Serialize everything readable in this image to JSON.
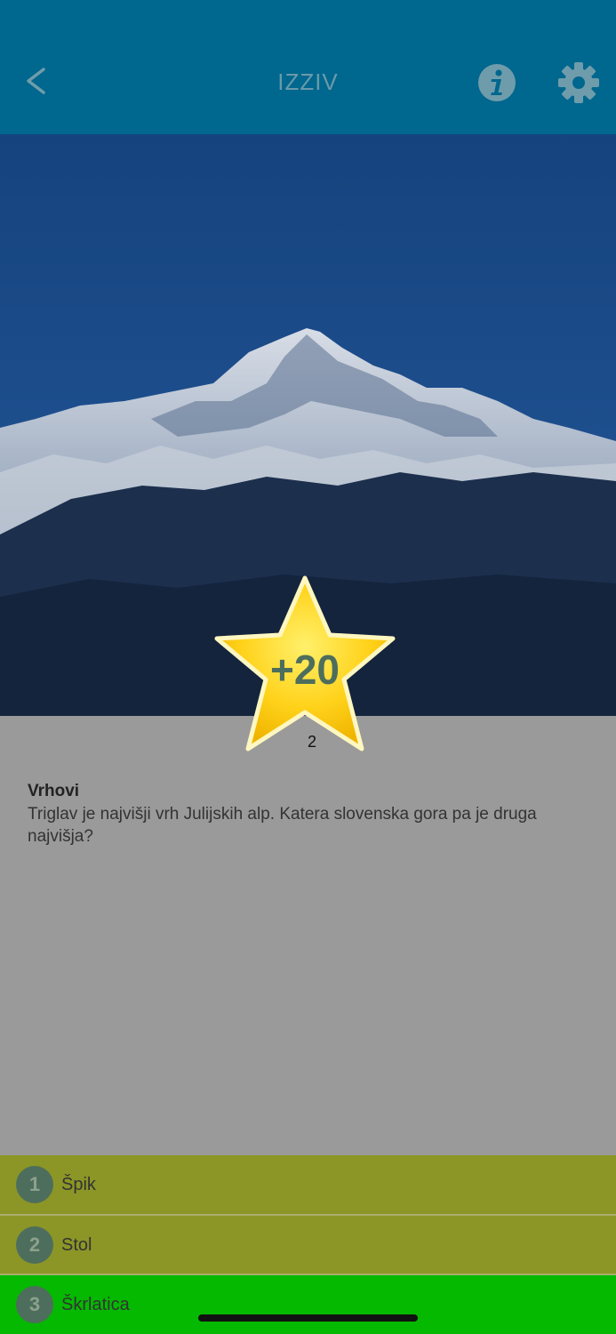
{
  "header": {
    "title": "IZZIV",
    "icons": {
      "back": "chevron-left-icon",
      "info": "info-icon",
      "settings": "gear-icon"
    }
  },
  "reward": {
    "value": "+20",
    "level": "2"
  },
  "question": {
    "title": "Vrhovi",
    "text": "Triglav je najvišji vrh Julijskih alp. Katera slovenska gora pa je druga najvišja?"
  },
  "answers": [
    {
      "number": "1",
      "label": "Špik",
      "state": "wrong"
    },
    {
      "number": "2",
      "label": "Stol",
      "state": "wrong"
    },
    {
      "number": "3",
      "label": "Škrlatica",
      "state": "correct"
    }
  ],
  "colors": {
    "header": "#00678e",
    "answer_wrong": "#8c9626",
    "answer_correct": "#05b900",
    "badge": "#4d6e5c",
    "star": "#ffd21a"
  }
}
